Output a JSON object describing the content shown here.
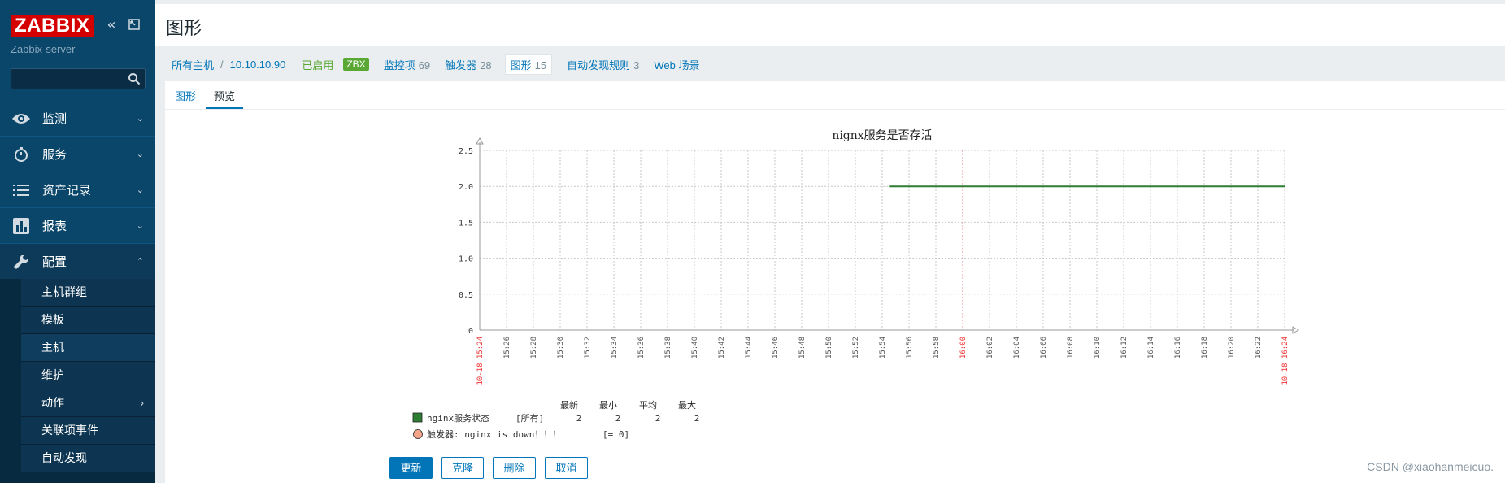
{
  "sidebar": {
    "logo": "ZABBIX",
    "server_name": "Zabbix-server",
    "search_placeholder": "",
    "nav": [
      {
        "label": "监测",
        "icon": "eye-icon"
      },
      {
        "label": "服务",
        "icon": "stopwatch-icon"
      },
      {
        "label": "资产记录",
        "icon": "list-icon"
      },
      {
        "label": "报表",
        "icon": "bar-chart-icon"
      },
      {
        "label": "配置",
        "icon": "wrench-icon"
      }
    ],
    "submenu": [
      "主机群组",
      "模板",
      "主机",
      "维护",
      "动作",
      "关联项事件",
      "自动发现"
    ],
    "selected_submenu": "主机"
  },
  "header": {
    "title": "图形"
  },
  "breadcrumb": {
    "all_hosts": "所有主机",
    "host": "10.10.10.90",
    "enabled": "已启用",
    "zbx": "ZBX",
    "items_label": "监控项",
    "items_count": "69",
    "triggers_label": "触发器",
    "triggers_count": "28",
    "graphs_label": "图形",
    "graphs_count": "15",
    "discovery_label": "自动发现规则",
    "discovery_count": "3",
    "web_label": "Web 场景"
  },
  "tabs": {
    "graph": "图形",
    "preview": "预览"
  },
  "chart_data": {
    "type": "line",
    "title": "nignx服务是否存活",
    "ylim": [
      0,
      2.5
    ],
    "y_ticks": [
      "0",
      "0.5",
      "1.0",
      "1.5",
      "2.0",
      "2.5"
    ],
    "x_ticks": [
      "10-18 15:24",
      "15:26",
      "15:28",
      "15:30",
      "15:32",
      "15:34",
      "15:36",
      "15:38",
      "15:40",
      "15:42",
      "15:44",
      "15:46",
      "15:48",
      "15:50",
      "15:52",
      "15:54",
      "15:56",
      "15:58",
      "16:00",
      "16:02",
      "16:04",
      "16:06",
      "16:08",
      "16:10",
      "16:12",
      "16:14",
      "16:16",
      "16:18",
      "16:20",
      "16:22",
      "10-18 16:24"
    ],
    "grid": true,
    "series": [
      {
        "name": "nginx服务状态",
        "color": "#2e7d32",
        "x": [
          "15:54.5",
          "16:24"
        ],
        "values": [
          2,
          2
        ]
      }
    ],
    "legend_headers": [
      "最新",
      "最小",
      "平均",
      "最大"
    ],
    "legend_rows": [
      {
        "name": "nginx服务状态",
        "func": "[所有]",
        "last": "2",
        "min": "2",
        "avg": "2",
        "max": "2",
        "color": "#2e7d32"
      }
    ],
    "trigger": {
      "label": "触发器: nginx is down！！！",
      "cond": "[= 0]",
      "color": "#f4a58a"
    }
  },
  "buttons": {
    "update": "更新",
    "clone": "克隆",
    "delete": "删除",
    "cancel": "取消"
  },
  "watermark": "CSDN @xiaohanmeicuo."
}
